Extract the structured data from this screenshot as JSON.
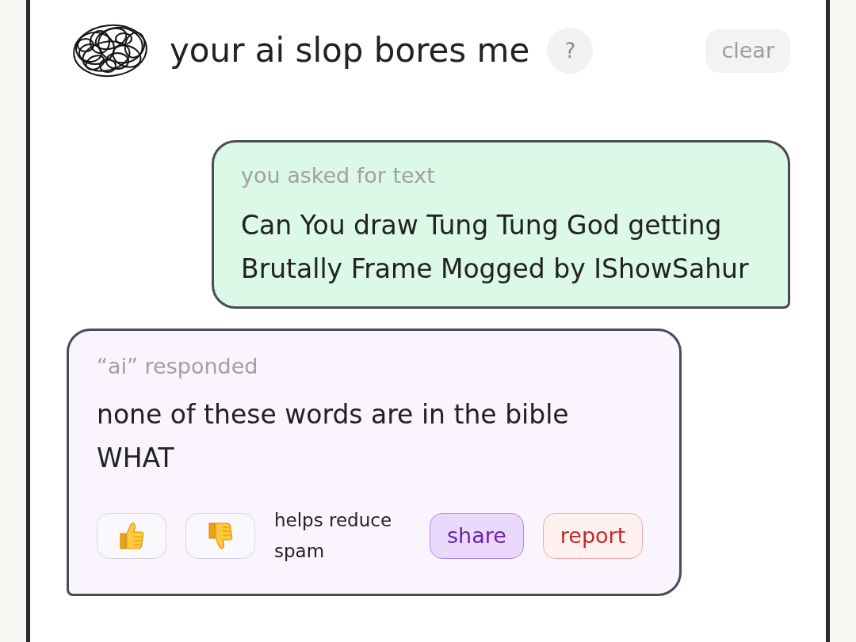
{
  "header": {
    "title": "your ai slop bores me",
    "help_button": "?",
    "clear_button": "clear"
  },
  "messages": [
    {
      "kind": "user",
      "label": "you asked for text",
      "text": "Can You draw Tung Tung God getting Brutally Frame Mogged by IShowSahur"
    },
    {
      "kind": "ai",
      "label": "“ai” responded",
      "text": "none of these words are in the bible\nWHAT",
      "feedback": {
        "note": "helps reduce spam",
        "share_button": "share",
        "report_button": "report"
      }
    }
  ]
}
